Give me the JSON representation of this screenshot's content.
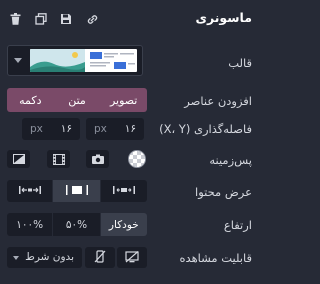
{
  "header": {
    "title": "ماسونری",
    "icons": [
      "link-icon",
      "save-icon",
      "copy-icon",
      "delete-icon"
    ]
  },
  "template": {
    "label": "قالب"
  },
  "add_elements": {
    "label": "افزودن عناصر",
    "options": [
      "تصویر",
      "متن",
      "دکمه"
    ]
  },
  "spacing": {
    "label": "فاصله‌گذاری (X، Y)",
    "x": {
      "value": "۱۶",
      "unit": "px"
    },
    "y": {
      "value": "۱۶",
      "unit": "px"
    }
  },
  "background": {
    "label": "پس‌زمینه",
    "icons": [
      "color-swatch-icon",
      "camera-icon",
      "film-icon",
      "gradient-icon"
    ]
  },
  "content_width": {
    "label": "عرض محتوا",
    "icons": [
      "shrink-width-icon",
      "box-width-icon",
      "full-width-icon"
    ],
    "selected": 1
  },
  "height": {
    "label": "ارتفاع",
    "options": [
      "خودکار",
      "۵۰%",
      "۱۰۰%"
    ],
    "selected": "خودکار"
  },
  "visibility": {
    "label": "قابلیت مشاهده",
    "condition": "بدون شرط",
    "icons": [
      "hide-desktop-icon",
      "hide-mobile-icon"
    ]
  },
  "colors": {
    "bg": "#262a36",
    "control": "#1a1d27",
    "accent": "#7a4a68",
    "active": "#3a3f4c"
  }
}
